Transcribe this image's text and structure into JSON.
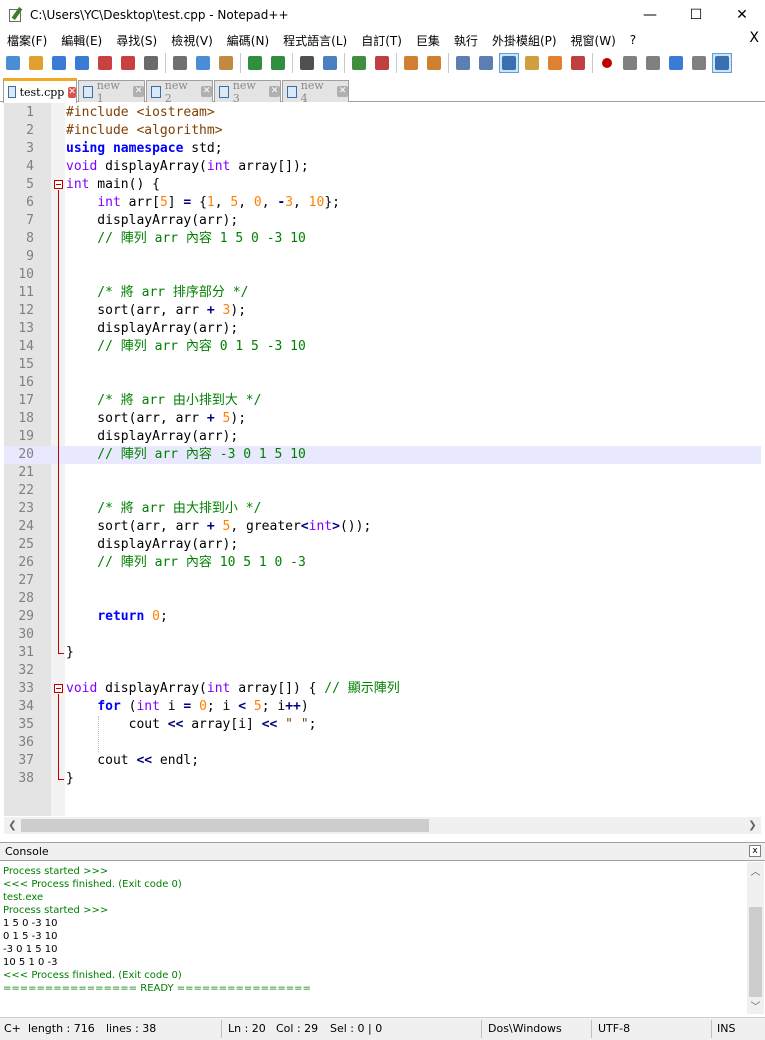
{
  "window": {
    "title": "C:\\Users\\YC\\Desktop\\test.cpp - Notepad++",
    "minimize": "—",
    "maximize": "☐",
    "close": "✕"
  },
  "menu": [
    "檔案(F)",
    "編輯(E)",
    "尋找(S)",
    "檢視(V)",
    "編碼(N)",
    "程式語言(L)",
    "自訂(T)",
    "巨集",
    "執行",
    "外掛模組(P)",
    "視窗(W)",
    "?"
  ],
  "menu_close": "X",
  "tabs": [
    {
      "label": "test.cpp",
      "active": true
    },
    {
      "label": "new 1",
      "active": false
    },
    {
      "label": "new 2",
      "active": false
    },
    {
      "label": "new 3",
      "active": false
    },
    {
      "label": "new 4",
      "active": false
    }
  ],
  "editor": {
    "current_line": 20,
    "lines": [
      {
        "n": "1",
        "segs": [
          [
            "p",
            "#include <iostream>"
          ]
        ]
      },
      {
        "n": "2",
        "segs": [
          [
            "p",
            "#include <algorithm>"
          ]
        ]
      },
      {
        "n": "3",
        "segs": [
          [
            "k",
            "using"
          ],
          [
            "d",
            " "
          ],
          [
            "k",
            "namespace"
          ],
          [
            "d",
            " std;"
          ]
        ]
      },
      {
        "n": "4",
        "segs": [
          [
            "t",
            "void"
          ],
          [
            "d",
            " displayArray("
          ],
          [
            "t",
            "int"
          ],
          [
            "d",
            " array[]);"
          ]
        ]
      },
      {
        "n": "5",
        "segs": [
          [
            "t",
            "int"
          ],
          [
            "d",
            " main() {"
          ]
        ]
      },
      {
        "n": "6",
        "segs": [
          [
            "d",
            "    "
          ],
          [
            "t",
            "int"
          ],
          [
            "d",
            " arr["
          ],
          [
            "n",
            "5"
          ],
          [
            "d",
            "] "
          ],
          [
            "o",
            "="
          ],
          [
            "d",
            " {"
          ],
          [
            "n",
            "1"
          ],
          [
            "d",
            ", "
          ],
          [
            "n",
            "5"
          ],
          [
            "d",
            ", "
          ],
          [
            "n",
            "0"
          ],
          [
            "d",
            ", "
          ],
          [
            "o",
            "-"
          ],
          [
            "n",
            "3"
          ],
          [
            "d",
            ", "
          ],
          [
            "n",
            "10"
          ],
          [
            "d",
            "};"
          ]
        ]
      },
      {
        "n": "7",
        "segs": [
          [
            "d",
            "    displayArray(arr);"
          ]
        ]
      },
      {
        "n": "8",
        "segs": [
          [
            "c",
            "    // 陣列 arr 內容 1 5 0 -3 10"
          ]
        ]
      },
      {
        "n": "9",
        "segs": []
      },
      {
        "n": "10",
        "segs": []
      },
      {
        "n": "11",
        "segs": [
          [
            "c",
            "    /* 將 arr 排序部分 */"
          ]
        ]
      },
      {
        "n": "12",
        "segs": [
          [
            "d",
            "    sort(arr, arr "
          ],
          [
            "o",
            "+"
          ],
          [
            "d",
            " "
          ],
          [
            "n",
            "3"
          ],
          [
            "d",
            ");"
          ]
        ]
      },
      {
        "n": "13",
        "segs": [
          [
            "d",
            "    displayArray(arr);"
          ]
        ]
      },
      {
        "n": "14",
        "segs": [
          [
            "c",
            "    // 陣列 arr 內容 0 1 5 -3 10"
          ]
        ]
      },
      {
        "n": "15",
        "segs": []
      },
      {
        "n": "16",
        "segs": []
      },
      {
        "n": "17",
        "segs": [
          [
            "c",
            "    /* 將 arr 由小排到大 */"
          ]
        ]
      },
      {
        "n": "18",
        "segs": [
          [
            "d",
            "    sort(arr, arr "
          ],
          [
            "o",
            "+"
          ],
          [
            "d",
            " "
          ],
          [
            "n",
            "5"
          ],
          [
            "d",
            ");"
          ]
        ]
      },
      {
        "n": "19",
        "segs": [
          [
            "d",
            "    displayArray(arr);"
          ]
        ]
      },
      {
        "n": "20",
        "segs": [
          [
            "c",
            "    // 陣列 arr 內容 -3 0 1 5 10"
          ]
        ]
      },
      {
        "n": "21",
        "segs": []
      },
      {
        "n": "22",
        "segs": []
      },
      {
        "n": "23",
        "segs": [
          [
            "c",
            "    /* 將 arr 由大排到小 */"
          ]
        ]
      },
      {
        "n": "24",
        "segs": [
          [
            "d",
            "    sort(arr, arr "
          ],
          [
            "o",
            "+"
          ],
          [
            "d",
            " "
          ],
          [
            "n",
            "5"
          ],
          [
            "d",
            ", greater"
          ],
          [
            "o",
            "<"
          ],
          [
            "t",
            "int"
          ],
          [
            "o",
            ">"
          ],
          [
            "d",
            "());"
          ]
        ]
      },
      {
        "n": "25",
        "segs": [
          [
            "d",
            "    displayArray(arr);"
          ]
        ]
      },
      {
        "n": "26",
        "segs": [
          [
            "c",
            "    // 陣列 arr 內容 10 5 1 0 -3"
          ]
        ]
      },
      {
        "n": "27",
        "segs": []
      },
      {
        "n": "28",
        "segs": []
      },
      {
        "n": "29",
        "segs": [
          [
            "d",
            "    "
          ],
          [
            "k",
            "return"
          ],
          [
            "d",
            " "
          ],
          [
            "n",
            "0"
          ],
          [
            "d",
            ";"
          ]
        ]
      },
      {
        "n": "30",
        "segs": []
      },
      {
        "n": "31",
        "segs": [
          [
            "d",
            "}"
          ]
        ]
      },
      {
        "n": "32",
        "segs": []
      },
      {
        "n": "33",
        "segs": [
          [
            "t",
            "void"
          ],
          [
            "d",
            " displayArray("
          ],
          [
            "t",
            "int"
          ],
          [
            "d",
            " array[]) { "
          ],
          [
            "c",
            "// 顯示陣列"
          ]
        ]
      },
      {
        "n": "34",
        "segs": [
          [
            "d",
            "    "
          ],
          [
            "k",
            "for"
          ],
          [
            "d",
            " ("
          ],
          [
            "t",
            "int"
          ],
          [
            "d",
            " i "
          ],
          [
            "o",
            "="
          ],
          [
            "d",
            " "
          ],
          [
            "n",
            "0"
          ],
          [
            "d",
            "; i "
          ],
          [
            "o",
            "<"
          ],
          [
            "d",
            " "
          ],
          [
            "n",
            "5"
          ],
          [
            "d",
            "; i"
          ],
          [
            "o",
            "++"
          ],
          [
            "d",
            ")"
          ]
        ]
      },
      {
        "n": "35",
        "segs": [
          [
            "d",
            "        cout "
          ],
          [
            "o",
            "<<"
          ],
          [
            "d",
            " array[i] "
          ],
          [
            "o",
            "<<"
          ],
          [
            "d",
            " "
          ],
          [
            "p",
            "\" \""
          ],
          [
            "d",
            ";"
          ]
        ]
      },
      {
        "n": "36",
        "segs": []
      },
      {
        "n": "37",
        "segs": [
          [
            "d",
            "    cout "
          ],
          [
            "o",
            "<<"
          ],
          [
            "d",
            " endl;"
          ]
        ]
      },
      {
        "n": "38",
        "segs": [
          [
            "d",
            "}"
          ]
        ]
      }
    ]
  },
  "console": {
    "title": "Console",
    "close": "x",
    "lines": [
      {
        "text": "Process started >>>",
        "color": "green"
      },
      {
        "text": "<<< Process finished. (Exit code 0)",
        "color": "green"
      },
      {
        "text": "test.exe",
        "color": "green"
      },
      {
        "text": "Process started >>>",
        "color": "green"
      },
      {
        "text": "1 5 0 -3 10",
        "color": "black"
      },
      {
        "text": "0 1 5 -3 10",
        "color": "black"
      },
      {
        "text": "-3 0 1 5 10",
        "color": "black"
      },
      {
        "text": "10 5 1 0 -3",
        "color": "black"
      },
      {
        "text": "<<< Process finished. (Exit code 0)",
        "color": "green"
      },
      {
        "text": "================ READY ================",
        "color": "green"
      }
    ]
  },
  "status": {
    "lang": "C+",
    "length": "length : 716",
    "lines": "lines : 38",
    "ln": "Ln : 20",
    "col": "Col : 29",
    "sel": "Sel : 0 | 0",
    "eol": "Dos\\Windows",
    "encoding": "UTF-8",
    "mode": "INS"
  },
  "colors": {
    "keyword": "#0000ff",
    "type": "#8000ff",
    "number": "#ff8000",
    "operator": "#000080",
    "preprocessor": "#804000",
    "comment": "#008000",
    "current_line": "#e8e8ff",
    "fold_marker": "#c00000"
  },
  "toolbar_icons": [
    "new-file-icon",
    "open-file-icon",
    "save-icon",
    "save-all-icon",
    "close-icon",
    "close-all-icon",
    "print-icon",
    "cut-icon",
    "copy-icon",
    "paste-icon",
    "undo-icon",
    "redo-icon",
    "find-icon",
    "replace-icon",
    "zoom-in-icon",
    "zoom-out-icon",
    "sync-vertical-icon",
    "sync-horizontal-icon",
    "word-wrap-icon",
    "show-all-chars-icon",
    "indent-guide-icon",
    "document-map-icon",
    "function-list-icon",
    "folder-workspace-icon",
    "record-macro-icon",
    "stop-macro-icon",
    "play-macro-icon",
    "run-macro-multiple-icon",
    "save-macro-icon",
    "console-icon"
  ]
}
